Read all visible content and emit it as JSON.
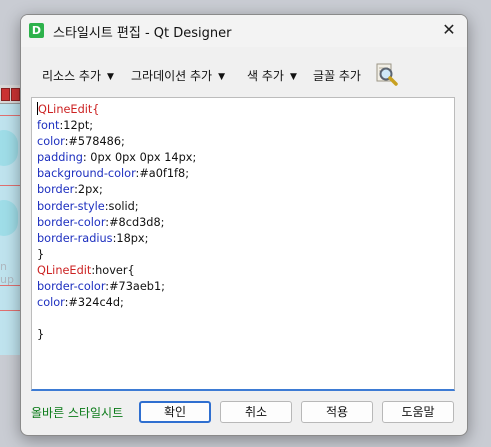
{
  "window": {
    "title": "스타일시트 편집 - Qt Designer",
    "app_icon_letter": "D",
    "close_glyph": "✕"
  },
  "background": {
    "partial_text": "n up"
  },
  "toolbar": {
    "add_resource": "리소스 추가",
    "add_gradient": "그라데이션 추가",
    "add_color": "색 추가",
    "add_font": "글꼴 추가",
    "dropdown_glyph": "▼"
  },
  "editor": {
    "lines": [
      {
        "sel": "QLineEdit{"
      },
      {
        "prop": "font",
        "val": ":12pt;"
      },
      {
        "prop": "color",
        "val": ":#578486;"
      },
      {
        "prop": "padding",
        "val": ": 0px 0px 0px 14px;"
      },
      {
        "prop": "background-color",
        "val": ":#a0f1f8;"
      },
      {
        "prop": "border",
        "val": ":2px;"
      },
      {
        "prop": "border-style",
        "val": ":solid;"
      },
      {
        "prop": "border-color",
        "val": ":#8cd3d8;"
      },
      {
        "prop": "border-radius",
        "val": ":18px;"
      },
      {
        "val": "}"
      },
      {
        "sel": "QLineEdit",
        "val": ":hover{"
      },
      {
        "prop": "border-color",
        "val": ":#73aeb1;"
      },
      {
        "prop": "color",
        "val": ":#324c4d;"
      },
      {
        "val": ""
      },
      {
        "val": "}"
      }
    ]
  },
  "status": {
    "text": "올바른 스타일시트"
  },
  "buttons": {
    "ok": "확인",
    "cancel": "취소",
    "apply": "적용",
    "help": "도움말"
  },
  "colors": {
    "selector": "#cc2222",
    "property": "#1d2fbf",
    "status_valid": "#0a7a18",
    "focus_accent": "#2f6fd0"
  }
}
